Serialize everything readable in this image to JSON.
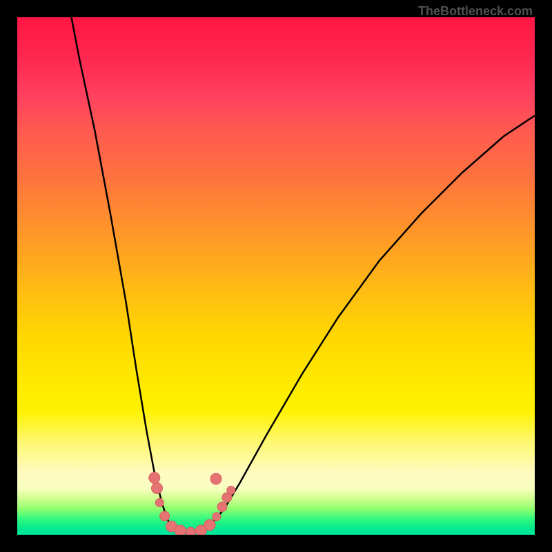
{
  "watermark": "TheBottleneck.com",
  "chart_data": {
    "type": "line",
    "title": "",
    "xlabel": "",
    "ylabel": "",
    "series": [
      {
        "name": "curve",
        "points": [
          {
            "x": 0.095,
            "y": 1.05
          },
          {
            "x": 0.12,
            "y": 0.92
          },
          {
            "x": 0.15,
            "y": 0.78
          },
          {
            "x": 0.18,
            "y": 0.62
          },
          {
            "x": 0.21,
            "y": 0.45
          },
          {
            "x": 0.23,
            "y": 0.32
          },
          {
            "x": 0.25,
            "y": 0.2
          },
          {
            "x": 0.265,
            "y": 0.12
          },
          {
            "x": 0.28,
            "y": 0.06
          },
          {
            "x": 0.29,
            "y": 0.03
          },
          {
            "x": 0.3,
            "y": 0.012
          },
          {
            "x": 0.31,
            "y": 0.005
          },
          {
            "x": 0.33,
            "y": 0.003
          },
          {
            "x": 0.35,
            "y": 0.005
          },
          {
            "x": 0.37,
            "y": 0.015
          },
          {
            "x": 0.4,
            "y": 0.05
          },
          {
            "x": 0.43,
            "y": 0.1
          },
          {
            "x": 0.48,
            "y": 0.19
          },
          {
            "x": 0.55,
            "y": 0.31
          },
          {
            "x": 0.62,
            "y": 0.42
          },
          {
            "x": 0.7,
            "y": 0.53
          },
          {
            "x": 0.78,
            "y": 0.62
          },
          {
            "x": 0.86,
            "y": 0.7
          },
          {
            "x": 0.94,
            "y": 0.77
          },
          {
            "x": 1.0,
            "y": 0.81
          }
        ]
      }
    ],
    "markers": [
      {
        "x": 0.265,
        "y": 0.11,
        "r": 8
      },
      {
        "x": 0.27,
        "y": 0.09,
        "r": 8
      },
      {
        "x": 0.275,
        "y": 0.062,
        "r": 6
      },
      {
        "x": 0.285,
        "y": 0.036,
        "r": 7
      },
      {
        "x": 0.298,
        "y": 0.016,
        "r": 8
      },
      {
        "x": 0.315,
        "y": 0.008,
        "r": 8
      },
      {
        "x": 0.335,
        "y": 0.005,
        "r": 7
      },
      {
        "x": 0.355,
        "y": 0.008,
        "r": 8
      },
      {
        "x": 0.372,
        "y": 0.019,
        "r": 8
      },
      {
        "x": 0.385,
        "y": 0.035,
        "r": 6
      },
      {
        "x": 0.396,
        "y": 0.054,
        "r": 7
      },
      {
        "x": 0.405,
        "y": 0.072,
        "r": 7
      },
      {
        "x": 0.413,
        "y": 0.086,
        "r": 6
      },
      {
        "x": 0.384,
        "y": 0.108,
        "r": 8
      }
    ],
    "xlim": [
      0,
      1
    ],
    "ylim": [
      0,
      1
    ],
    "background_gradient": {
      "top_color": "#ff1744",
      "bottom_color": "#00e890"
    }
  }
}
